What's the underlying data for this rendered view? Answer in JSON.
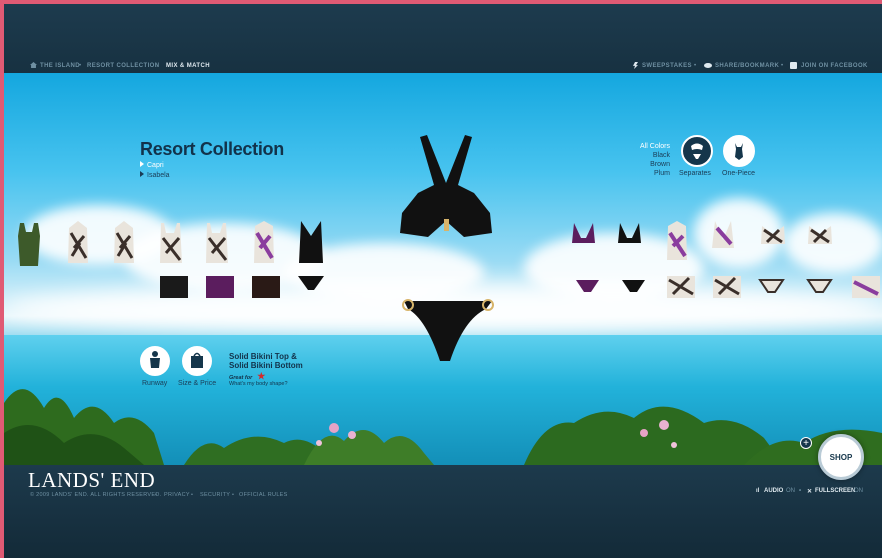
{
  "breadcrumb": {
    "home": "THE ISLAND",
    "collection": "RESORT COLLECTION",
    "current": "MIX & MATCH"
  },
  "top_links": {
    "sweeps": "SWEEPSTAKES",
    "share": "SHARE/BOOKMARK",
    "facebook": "JOIN ON FACEBOOK"
  },
  "resort": {
    "title": "Resort Collection",
    "links": [
      "Capri",
      "Isabela"
    ]
  },
  "colors": {
    "all": "All Colors",
    "items": [
      "Black",
      "Brown",
      "Plum"
    ]
  },
  "style_buttons": {
    "separates": "Separates",
    "onepiece": "One-Piece"
  },
  "bottom_buttons": {
    "runway": "Runway",
    "size": "Size & Price"
  },
  "product": {
    "title_line1": "Solid Bikini Top &",
    "title_line2": "Solid Bikini Bottom",
    "great_for": "Great for",
    "body_shape": "What's my body shape?"
  },
  "footer": {
    "logo": "LANDS' END",
    "copyright": "© 2009 LANDS' END. ALL RIGHTS RESERVED.",
    "privacy": "PRIVACY",
    "security": "SECURITY",
    "rules": "OFFICIAL RULES",
    "audio": "AUDIO",
    "audio_state": "ON",
    "fullscreen": "FULLSCREEN",
    "fullscreen_state": "ON"
  },
  "shop": {
    "label": "SHOP",
    "plus": "+"
  },
  "theme": {
    "accent": "#15364b",
    "frame": "#e05a74"
  }
}
